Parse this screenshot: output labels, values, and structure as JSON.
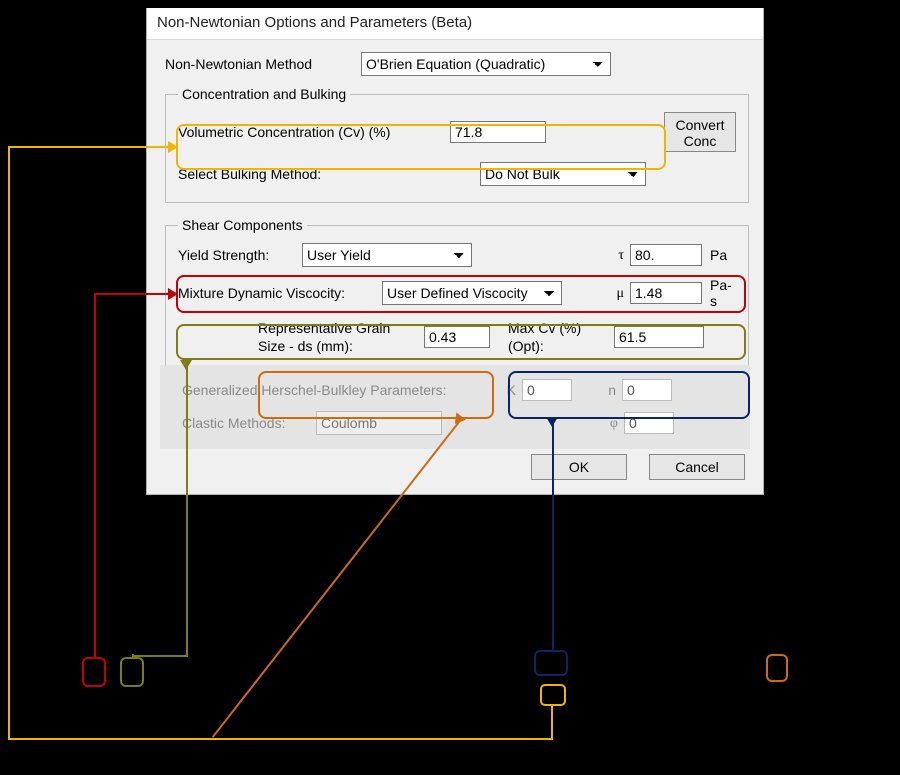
{
  "dialog": {
    "title": "Non-Newtonian Options and Parameters (Beta)"
  },
  "method": {
    "label": "Non-Newtonian Method",
    "value": "O'Brien Equation (Quadratic)"
  },
  "concentration_group": {
    "legend": "Concentration and Bulking",
    "cv_label": "Volumetric Concentration (Cv) (%)",
    "cv_value": "71.8",
    "convert_btn": "Convert Conc",
    "bulking_label": "Select Bulking Method:",
    "bulking_value": "Do Not Bulk"
  },
  "shear_group": {
    "legend": "Shear Components",
    "yield_label": "Yield Strength:",
    "yield_select": "User Yield",
    "tau_symbol": "τ",
    "tau_value": "80.",
    "tau_unit": "Pa",
    "visc_label": "Mixture Dynamic Viscocity:",
    "visc_select": "User Defined Viscocity",
    "mu_symbol": "μ",
    "mu_value": "1.48",
    "mu_unit": "Pa-s",
    "ds_label": "Representative Grain Size - ds (mm):",
    "ds_value": "0.43",
    "maxcv_label": "Max Cv (%) (Opt):",
    "maxcv_value": "61.5",
    "ghb_label": "Generalized Herschel-Bulkley Parameters:",
    "K_symbol": "K",
    "K_value": "0",
    "n_symbol": "n",
    "n_value": "0",
    "clastic_label": "Clastic Methods:",
    "clastic_select": "Coulomb",
    "phi_symbol": "φ",
    "phi_value": "0"
  },
  "footer": {
    "ok": "OK",
    "cancel": "Cancel"
  }
}
